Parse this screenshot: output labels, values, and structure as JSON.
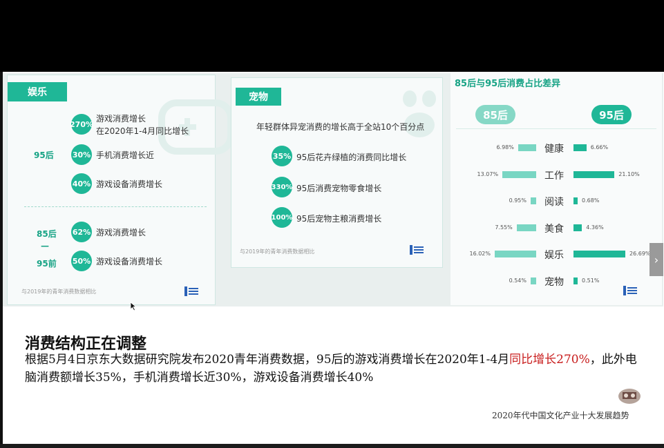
{
  "panel1": {
    "tag": "娱乐",
    "group1_label": "95后",
    "group2_label_a": "85后",
    "group2_dash": "—",
    "group2_label_b": "95前",
    "items": [
      {
        "pct": "270%",
        "line1": "游戏消费增长",
        "line2": "在2020年1-4月同比增长"
      },
      {
        "pct": "30%",
        "line1": "手机消费增长近"
      },
      {
        "pct": "40%",
        "line1": "游戏设备消费增长"
      },
      {
        "pct": "62%",
        "line1": "游戏消费增长"
      },
      {
        "pct": "50%",
        "line1": "游戏设备消费增长"
      }
    ],
    "footnote": "与2019年的青年消费数据相比"
  },
  "panel2": {
    "tag": "宠物",
    "headline": "年轻群体异宠消费的增长高于全站10个百分点",
    "items": [
      {
        "pct": "35%",
        "text": "95后花卉绿植的消费同比增长"
      },
      {
        "pct": "330%",
        "text": "95后消费宠物零食增长"
      },
      {
        "pct": "100%",
        "text": "95后宠物主粮消费增长"
      }
    ],
    "footnote": "与2019年的青年消费数据相比"
  },
  "panel3": {
    "title": "85后与95后消费占比差异",
    "left_pill": "85后",
    "right_pill": "95后",
    "rows": [
      {
        "cat": "健康",
        "left": "6.98%",
        "left_v": 6.98,
        "right": "6.66%",
        "right_v": 6.66
      },
      {
        "cat": "工作",
        "left": "13.07%",
        "left_v": 13.07,
        "right": "21.10%",
        "right_v": 21.1
      },
      {
        "cat": "阅读",
        "left": "0.95%",
        "left_v": 0.95,
        "right": "0.68%",
        "right_v": 0.68
      },
      {
        "cat": "美食",
        "left": "7.55%",
        "left_v": 7.55,
        "right": "4.36%",
        "right_v": 4.36
      },
      {
        "cat": "娱乐",
        "left": "16.02%",
        "left_v": 16.02,
        "right": "26.69%",
        "right_v": 26.69
      },
      {
        "cat": "宠物",
        "left": "0.54%",
        "left_v": 0.54,
        "right": "0.51%",
        "right_v": 0.51
      }
    ]
  },
  "text": {
    "title": "消费结构正在调整",
    "body_main": "根据5月4日京东大数据研究院发布2020青年消费数据，95后的游戏消费增长在2020年1-4月",
    "body_red": "同比增长270%",
    "body_rest": "，此外电脑消费额增长35%，手机消费增长近30%，游戏设备消费增长40%",
    "caption": "2020年代中国文化产业十大发展趋势"
  },
  "nav": {
    "next_symbol": "›"
  },
  "colors": {
    "accent": "#1fb797",
    "light_bar": "#79d6c3",
    "red_text": "#c81c1c"
  }
}
